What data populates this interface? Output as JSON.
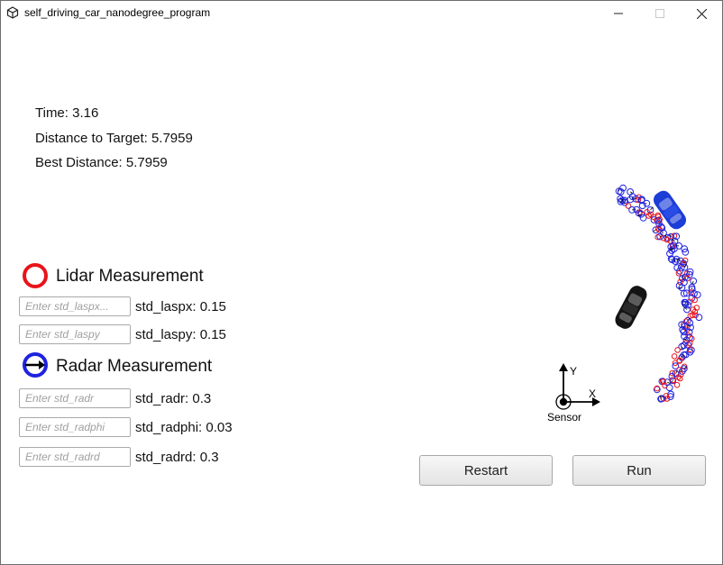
{
  "window": {
    "title": "self_driving_car_nanodegree_program"
  },
  "stats": {
    "time": "Time: 3.16",
    "distance_to_target": "Distance to Target: 5.7959",
    "best_distance": "Best Distance: 5.7959"
  },
  "lidar": {
    "legend_label": "Lidar Measurement",
    "color": "#e8141a",
    "params": [
      {
        "placeholder": "Enter std_laspx...",
        "label": "std_laspx: 0.15"
      },
      {
        "placeholder": "Enter std_laspy",
        "label": "std_laspy: 0.15"
      }
    ]
  },
  "radar": {
    "legend_label": "Radar Measurement",
    "color": "#1e22e0",
    "params": [
      {
        "placeholder": "Enter std_radr",
        "label": "std_radr: 0.3"
      },
      {
        "placeholder": "Enter std_radphi",
        "label": "std_radphi: 0.03"
      },
      {
        "placeholder": "Enter std_radrd",
        "label": "std_radrd: 0.3"
      }
    ]
  },
  "sensor_axes": {
    "x_label": "X",
    "y_label": "Y",
    "origin_label": "Sensor"
  },
  "buttons": {
    "restart": "Restart",
    "run": "Run"
  }
}
